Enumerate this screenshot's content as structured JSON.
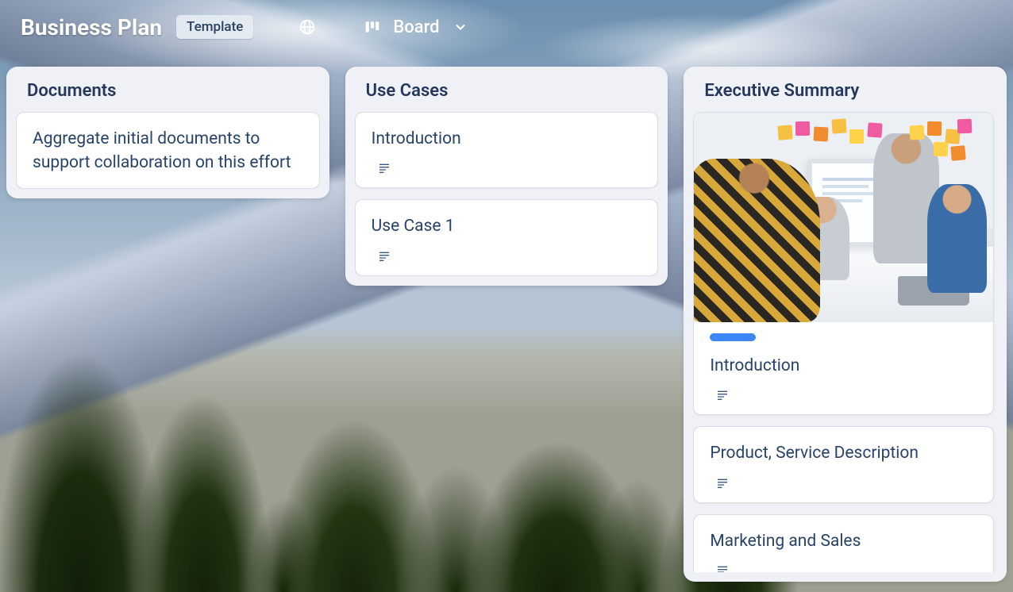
{
  "header": {
    "title": "Business Plan",
    "badge": "Template",
    "globe_icon": "globe-icon",
    "board_icon": "board-columns-icon",
    "view_label": "Board",
    "chevron_icon": "chevron-down-icon"
  },
  "columns": [
    {
      "title": "Documents",
      "cards": [
        {
          "title": "Aggregate initial documents to support collaboration on this effort",
          "has_desc_icon": false,
          "has_image": false,
          "has_pill": false
        }
      ]
    },
    {
      "title": "Use Cases",
      "cards": [
        {
          "title": "Introduction",
          "has_desc_icon": true,
          "has_image": false,
          "has_pill": false
        },
        {
          "title": "Use Case 1",
          "has_desc_icon": true,
          "has_image": false,
          "has_pill": false
        }
      ]
    },
    {
      "title": "Executive Summary",
      "cards": [
        {
          "title": "Introduction",
          "has_desc_icon": true,
          "has_image": true,
          "has_pill": true,
          "pill_color": "#3d87f5"
        },
        {
          "title": "Product, Service Description",
          "has_desc_icon": true,
          "has_image": false,
          "has_pill": false
        },
        {
          "title": "Marketing and Sales",
          "has_desc_icon": true,
          "has_image": false,
          "has_pill": false
        }
      ]
    }
  ],
  "sticky_colors": [
    "#f6c042",
    "#ef5aa0",
    "#f28a2e",
    "#f6c042",
    "#ffd24a",
    "#ef5aa0",
    "#ffd24a",
    "#f28a2e",
    "#f6c042",
    "#ef5aa0",
    "#ffd24a",
    "#f28a2e"
  ]
}
